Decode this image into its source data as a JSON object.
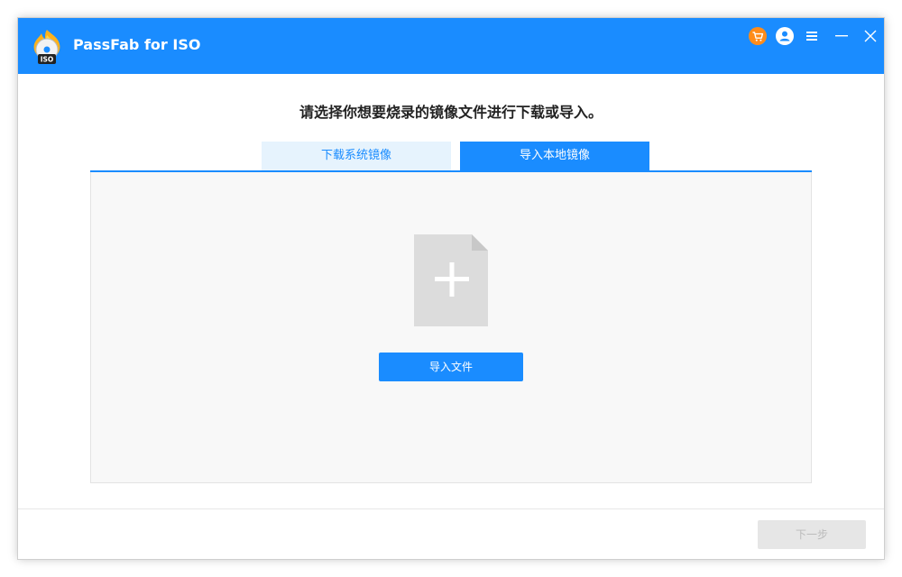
{
  "app": {
    "title": "PassFab for ISO",
    "logo_text": "ISO"
  },
  "titlebar_icons": [
    "cart-icon",
    "account-icon",
    "menu-icon",
    "minimize-icon",
    "close-icon"
  ],
  "headline": "请选择你想要烧录的镜像文件进行下载或导入。",
  "tabs": [
    {
      "label": "下载系统镜像",
      "active": false
    },
    {
      "label": "导入本地镜像",
      "active": true
    }
  ],
  "import_panel": {
    "icon": "add-file-icon",
    "button_label": "导入文件"
  },
  "footer": {
    "next_label": "下一步",
    "next_enabled": false
  },
  "colors": {
    "brand_blue": "#1a8cff",
    "cart_orange": "#ff8c1a",
    "tab_inactive_bg": "#e6f3fd",
    "panel_bg": "#f8f8f8",
    "disabled_button_bg": "#e6e6e6"
  }
}
